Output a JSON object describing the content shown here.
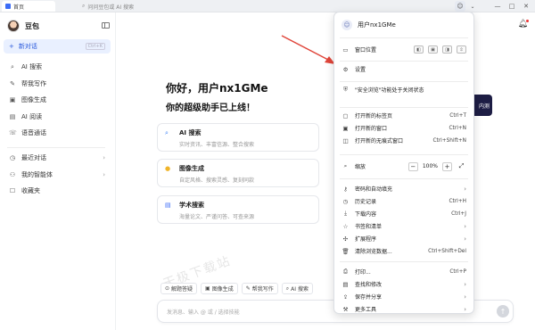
{
  "window": {
    "tab_title": "首页",
    "address_text": "问问豆包或 AI 搜索",
    "controls": [
      "—",
      "□",
      "✕"
    ]
  },
  "sidebar": {
    "brand": "豆包",
    "new_chat": "新对话",
    "new_chat_shortcut": "Ctrl+K",
    "items": [
      {
        "label": "AI 搜索",
        "icon": "search-icon"
      },
      {
        "label": "帮我写作",
        "icon": "pen-icon"
      },
      {
        "label": "图像生成",
        "icon": "image-icon"
      },
      {
        "label": "AI 阅读",
        "icon": "book-icon"
      },
      {
        "label": "语音通话",
        "icon": "phone-icon"
      }
    ],
    "groups": [
      {
        "label": "最近对话",
        "icon": "clock-icon"
      },
      {
        "label": "我的智能体",
        "icon": "agent-icon"
      },
      {
        "label": "收藏夹",
        "icon": "bookmark-icon"
      }
    ]
  },
  "main": {
    "greeting": "你好，用户nx1GMe",
    "subtitle": "你的超级助手已上线！",
    "cards": [
      {
        "title": "AI 搜索",
        "desc": "实时资讯、丰富信源、整合搜索",
        "icon": "search-icon",
        "color": "#3b82f6"
      },
      {
        "title": "图像生成",
        "desc": "自定风格、搜索灵感、复刻同款",
        "icon": "image-icon",
        "color": "#f0b429"
      },
      {
        "title": "学术搜索",
        "desc": "海量论文、严谨问答、可查来源",
        "icon": "book-icon",
        "color": "#3b6cf6"
      }
    ],
    "peek_button": "内测",
    "chips": [
      {
        "label": "解题答疑",
        "icon": "question-icon"
      },
      {
        "label": "图像生成",
        "icon": "image-icon"
      },
      {
        "label": "帮我写作",
        "icon": "pen-icon"
      },
      {
        "label": "AI 搜索",
        "icon": "search-icon"
      }
    ],
    "input_placeholder": "发消息、输入 @ 或 / 选择技能",
    "watermark": "天极下载站"
  },
  "menu": {
    "profile_name": "用户nx1GMe",
    "window_position": "窗口位置",
    "position_icons": [
      "◧",
      "▣",
      "◨",
      "⇳"
    ],
    "settings": "设置",
    "safe_browsing": "\"安全浏览\"功能处于关闭状态",
    "new_tab": {
      "label": "打开新的标签页",
      "shortcut": "Ctrl+T"
    },
    "new_window": {
      "label": "打开新的窗口",
      "shortcut": "Ctrl+N"
    },
    "incognito": {
      "label": "打开新的无痕式窗口",
      "shortcut": "Ctrl+Shift+N"
    },
    "zoom": {
      "label": "缩放",
      "value": "100%",
      "minus": "−",
      "plus": "+"
    },
    "passwords": "密码和自动填充",
    "history": "历史记录",
    "history_shortcut": "Ctrl+H",
    "downloads": "下载内容",
    "downloads_shortcut": "Ctrl+J",
    "bookmarks": "书签和清单",
    "extensions": "扩展程序",
    "clear_data": {
      "label": "清除浏览数据...",
      "shortcut": "Ctrl+Shift+Del"
    },
    "print": {
      "label": "打印...",
      "shortcut": "Ctrl+P"
    },
    "find": "查找和修改",
    "save_share": "保存并分享",
    "more_tools": "更多工具"
  },
  "colors": {
    "accent": "#2c5bdc",
    "arrow": "#e0453a"
  }
}
